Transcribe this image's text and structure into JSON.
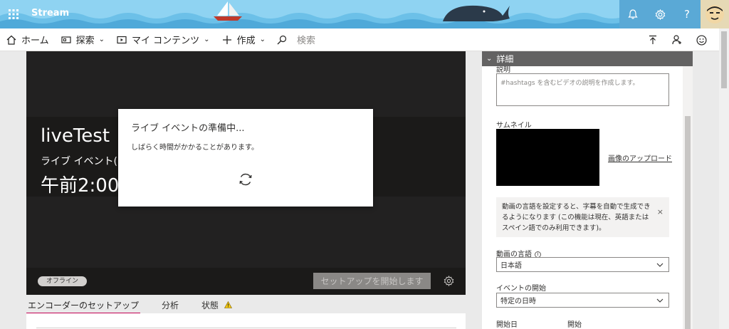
{
  "header": {
    "app_title": "Stream",
    "accent": "#5aa9d6",
    "icons": [
      "app-launcher-icon",
      "bell-icon",
      "gear-icon",
      "help-icon",
      "avatar"
    ]
  },
  "nav": {
    "home": "ホーム",
    "explore": "探索",
    "my_content": "マイ コンテンツ",
    "create": "作成",
    "search_placeholder": "検索"
  },
  "video": {
    "title": "liveTest",
    "subtitle": "ライブ イベント(",
    "time": "午前2:00",
    "status_badge": "オフライン",
    "start_setup_label": "セットアップを開始します"
  },
  "modal": {
    "title": "ライブ イベントの準備中...",
    "body": "しばらく時間がかかることがあります。"
  },
  "tabs": [
    {
      "label": "エンコーダーのセットアップ",
      "active": true
    },
    {
      "label": "分析",
      "active": false
    },
    {
      "label": "状態",
      "active": false
    }
  ],
  "details": {
    "header": "詳細",
    "description_label": "説明",
    "description_placeholder": "#hashtags を含むビデオの説明を作成します。",
    "thumbnail_label": "サムネイル",
    "upload_link": "画像のアップロード",
    "info_message": "動画の言語を設定すると、字幕を自動で生成できるようになります (この機能は現在、英語またはスペイン語でのみ利用できます)。",
    "video_language_label": "動画の言語",
    "video_language_value": "日本語",
    "event_start_label": "イベントの開始",
    "event_start_value": "特定の日時",
    "start_date_label": "開始日",
    "start_label": "開始"
  }
}
